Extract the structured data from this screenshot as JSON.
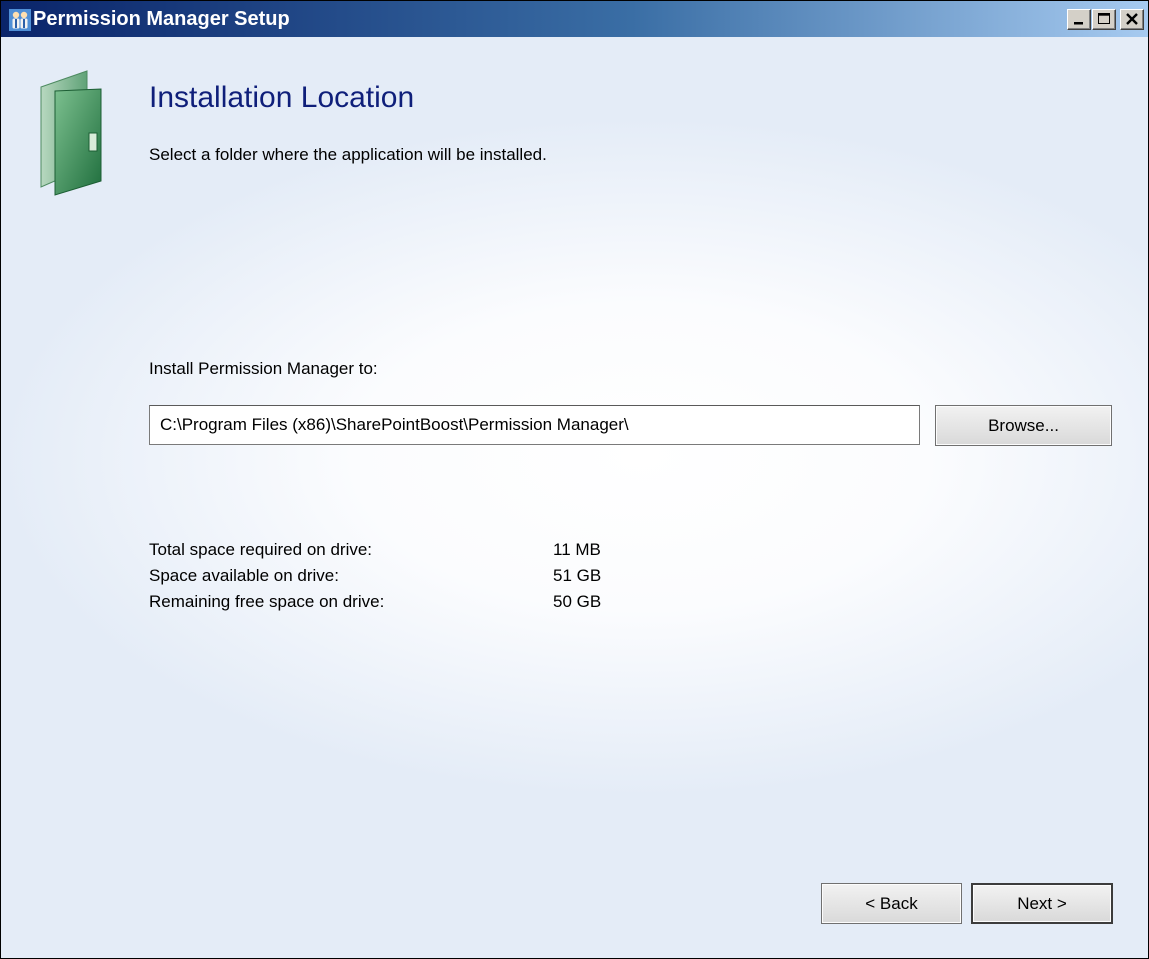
{
  "window": {
    "title": "Permission Manager Setup",
    "app_icon": "users-icon",
    "controls": [
      {
        "name": "minimize",
        "icon": "minimize-icon"
      },
      {
        "name": "maximize",
        "icon": "maximize-icon"
      },
      {
        "name": "close",
        "icon": "close-icon"
      }
    ]
  },
  "header": {
    "icon": "folder-icon",
    "title": "Installation Location",
    "subtitle": "Select a folder where the application will be installed."
  },
  "install": {
    "label": "Install Permission Manager to:",
    "path": "C:\\Program Files (x86)\\SharePointBoost\\Permission Manager\\",
    "browse_label": "Browse..."
  },
  "space": [
    {
      "label": "Total space required on drive:",
      "value": "11 MB"
    },
    {
      "label": "Space available on drive:",
      "value": "51 GB"
    },
    {
      "label": "Remaining free space on drive:",
      "value": "50 GB"
    }
  ],
  "nav": {
    "back_label": "< Back",
    "next_label": "Next >"
  },
  "colors": {
    "title_gradient_start": "#0a246a",
    "title_gradient_end": "#a6caf0",
    "heading": "#0f1f7a",
    "folder_green": "#2e8b57"
  }
}
